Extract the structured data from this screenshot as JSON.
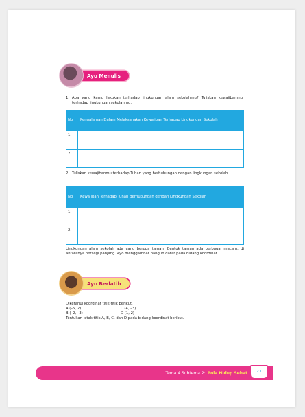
{
  "section1": {
    "banner": "Ayo Menulis"
  },
  "q1": {
    "num": "1.",
    "text": "Apa yang kamu lakukan terhadap lingkungan alam sekolahmu? Tuliskan kewajibanmu terhadap lingkungan sekolahmu."
  },
  "table1": {
    "headers": [
      "No",
      "Pengalaman Dalam Melaksanakan Kewajiban Terhadap Lingkungan Sekolah"
    ],
    "rows": [
      "1.",
      "2."
    ]
  },
  "q2": {
    "num": "2.",
    "text": "Tuliskan kewajibanmu terhadap Tuhan yang berhubungan dengan lingkungan sekolah."
  },
  "table2": {
    "headers": [
      "No",
      "Kewajiban Terhadap Tuhan Berhubungan dengan Lingkungan Sekolah"
    ],
    "rows": [
      "1.",
      "2."
    ]
  },
  "para1": "Lingkungan alam sekolah ada yang berupa taman. Bentuk taman ada berbagai macam, di antaranya persegi panjang. Ayo menggambar bangun datar pada bidang koordinat.",
  "section2": {
    "banner": "Ayo Berlatih"
  },
  "coords": {
    "intro": "Diketahui koordinat titik-titik berikut.",
    "points": [
      "A (–5, 2)",
      "C (4, –3)",
      "B (–2, –3)",
      "D (1, 2)"
    ],
    "instruction": "Tentukan letak titik A, B, C, dan D pada bidang koordinat berikut."
  },
  "footer": {
    "prefix": "Tema 4 Subtema 2:",
    "title": "Pola Hidup Sehat",
    "page": "71"
  },
  "colors": {
    "accent_blue": "#22a8e0",
    "pink": "#e8358a",
    "yellow": "#fbe35b"
  }
}
